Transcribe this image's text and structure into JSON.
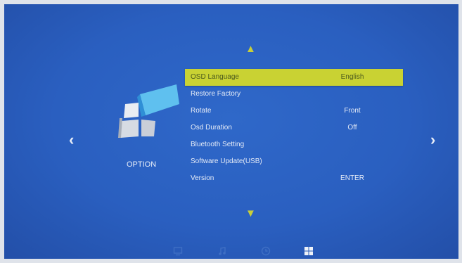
{
  "menu": {
    "items": [
      {
        "label": "OSD Language",
        "value": "English",
        "selected": true
      },
      {
        "label": "Restore Factory",
        "value": ""
      },
      {
        "label": "Rotate",
        "value": "Front"
      },
      {
        "label": "Osd Duration",
        "value": "Off"
      },
      {
        "label": "Bluetooth Setting",
        "value": ""
      },
      {
        "label": "Software Update(USB)",
        "value": ""
      },
      {
        "label": "Version",
        "value": "ENTER"
      }
    ]
  },
  "category": {
    "label": "OPTION",
    "icon": "option-cube-icon"
  },
  "nav": {
    "left": "‹",
    "right": "›",
    "up": "▲",
    "down": "▼"
  },
  "bottom_bar": {
    "icons": [
      "tv-icon",
      "music-icon",
      "clock-icon",
      "option-grid-icon"
    ],
    "active": "option-grid-icon"
  },
  "colors": {
    "background": "#2a5fc0",
    "highlight": "#c9d233",
    "arrow": "#c8cf3a",
    "text": "#e6ecf7"
  }
}
